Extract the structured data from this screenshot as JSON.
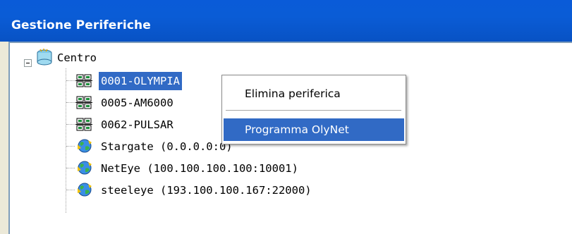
{
  "window": {
    "title": "Gestione Periferiche"
  },
  "tree": {
    "root": {
      "label": "Centro",
      "icon": "database-icon",
      "expanded": true
    },
    "children": [
      {
        "label": "0001-OLYMPIA",
        "icon": "network-device-icon",
        "selected": true
      },
      {
        "label": "0005-AM6000",
        "icon": "network-device-icon",
        "selected": false
      },
      {
        "label": "0062-PULSAR",
        "icon": "network-device-icon",
        "selected": false
      },
      {
        "label": "Stargate (0.0.0.0:0)",
        "icon": "globe-icon",
        "selected": false
      },
      {
        "label": "NetEye (100.100.100.100:10001)",
        "icon": "globe-icon",
        "selected": false
      },
      {
        "label": "steeleye (193.100.100.167:22000)",
        "icon": "globe-icon",
        "selected": false
      }
    ]
  },
  "context_menu": {
    "items": [
      {
        "label": "Elimina periferica",
        "highlighted": false
      },
      {
        "label": "Programma OlyNet",
        "highlighted": true
      }
    ]
  },
  "colors": {
    "titlebar": "#0a5cd6",
    "selection": "#316ac5",
    "panel_border": "#7f9db9",
    "window_bg": "#ece9d8"
  }
}
